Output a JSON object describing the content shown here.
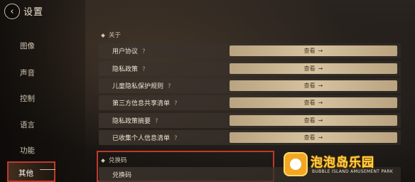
{
  "header": {
    "title": "设置",
    "back_icon": "‹"
  },
  "sidebar": {
    "items": [
      {
        "label": "图像"
      },
      {
        "label": "声音"
      },
      {
        "label": "控制"
      },
      {
        "label": "语言"
      },
      {
        "label": "功能"
      },
      {
        "label": "其他",
        "active": true
      }
    ]
  },
  "sections": {
    "about": {
      "title": "关于"
    },
    "redeem": {
      "title": "兑换码"
    }
  },
  "rows": [
    {
      "label": "用户协议",
      "help": "?",
      "button": "查看"
    },
    {
      "label": "隐私政策",
      "help": "?",
      "button": "查看"
    },
    {
      "label": "儿童隐私保护规则",
      "help": "?",
      "button": "查看"
    },
    {
      "label": "第三方信息共享清单",
      "help": "?",
      "button": "查看"
    },
    {
      "label": "隐私政策摘要",
      "help": "?",
      "button": "查看"
    },
    {
      "label": "已收集个人信息清单",
      "help": "?",
      "button": "查看"
    }
  ],
  "redeem_row": {
    "label": "兑换码"
  },
  "watermark": {
    "title": "泡泡岛乐园",
    "subtitle": "BUBBLE ISLAND AMUSEMENT PARK"
  },
  "colors": {
    "accent": "#c0392b",
    "button": "#d6c3a0",
    "logo": "#ffd24a"
  }
}
